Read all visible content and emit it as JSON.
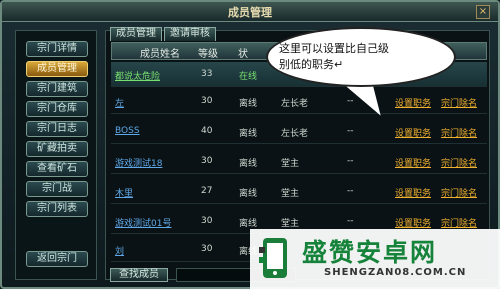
{
  "window": {
    "title": "成员管理",
    "close_label": "×"
  },
  "sidebar": {
    "items": [
      {
        "label": "宗门详情",
        "active": false
      },
      {
        "label": "成员管理",
        "active": true
      },
      {
        "label": "宗门建筑",
        "active": false
      },
      {
        "label": "宗门仓库",
        "active": false
      },
      {
        "label": "宗门日志",
        "active": false
      },
      {
        "label": "矿藏拍卖",
        "active": false
      },
      {
        "label": "查看矿石",
        "active": false
      },
      {
        "label": "宗门战",
        "active": false
      },
      {
        "label": "宗门列表",
        "active": false
      }
    ],
    "return_label": "返回宗门"
  },
  "tabs": [
    {
      "label": "成员管理",
      "active": true
    },
    {
      "label": "邀请审核",
      "active": false
    }
  ],
  "table": {
    "headers": [
      "成员姓名",
      "等级",
      "状"
    ],
    "rows": [
      {
        "name": "都说太危险",
        "level": "33",
        "status": "在线",
        "position": "",
        "contrib": "",
        "highlight": true,
        "name_green": true,
        "status_green": true,
        "actions": []
      },
      {
        "name": "左",
        "level": "30",
        "status": "离线",
        "position": "左长老",
        "contrib": "--",
        "actions": [
          "设置职务",
          "宗门除名"
        ]
      },
      {
        "name": "BOSS",
        "level": "40",
        "status": "离线",
        "position": "左长老",
        "contrib": "--",
        "actions": [
          "设置职务",
          "宗门除名"
        ]
      },
      {
        "name": "游戏测试18",
        "level": "30",
        "status": "离线",
        "position": "堂主",
        "contrib": "--",
        "actions": [
          "设置职务",
          "宗门除名"
        ]
      },
      {
        "name": "木里",
        "level": "27",
        "status": "离线",
        "position": "堂主",
        "contrib": "--",
        "actions": [
          "设置职务",
          "宗门除名"
        ]
      },
      {
        "name": "游戏测试01号",
        "level": "30",
        "status": "离线",
        "position": "堂主",
        "contrib": "--",
        "actions": [
          "设置职务",
          "宗门除名"
        ]
      },
      {
        "name": "刘",
        "level": "30",
        "status": "离线",
        "position": "",
        "contrib": "",
        "actions": []
      }
    ]
  },
  "search": {
    "button_label": "查找成员",
    "value": ""
  },
  "annotation": {
    "line1": "这里可以设置比自己级",
    "line2": "别低的职务↵"
  },
  "watermark": {
    "brand": "盛赞安卓网",
    "url": "SHENGZAN08.COM.CN"
  }
}
